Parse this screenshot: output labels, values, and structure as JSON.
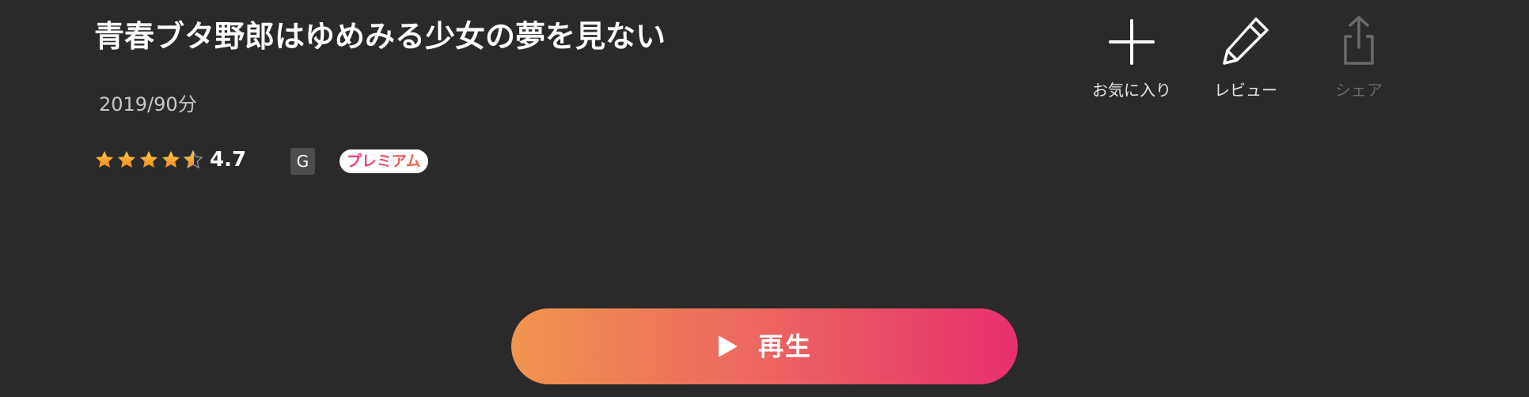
{
  "title": "青春ブタ野郎はゆめみる少女の夢を見ない",
  "meta": "2019/90分",
  "rating": {
    "value": "4.7",
    "stars_filled_fraction": 0.94
  },
  "age_rating": "G",
  "premium_badge": "プレミアム",
  "actions": {
    "favorite": {
      "label": "お気に入り",
      "icon": "plus-icon"
    },
    "review": {
      "label": "レビュー",
      "icon": "pencil-icon"
    },
    "share": {
      "label": "シェア",
      "icon": "share-icon",
      "enabled": false
    }
  },
  "play_button": {
    "label": "再生",
    "icon": "play-icon"
  },
  "colors": {
    "background": "#2a2a2a",
    "star": "#f7a325",
    "play_gradient_start": "#f0954f",
    "play_gradient_end": "#e8306f"
  }
}
